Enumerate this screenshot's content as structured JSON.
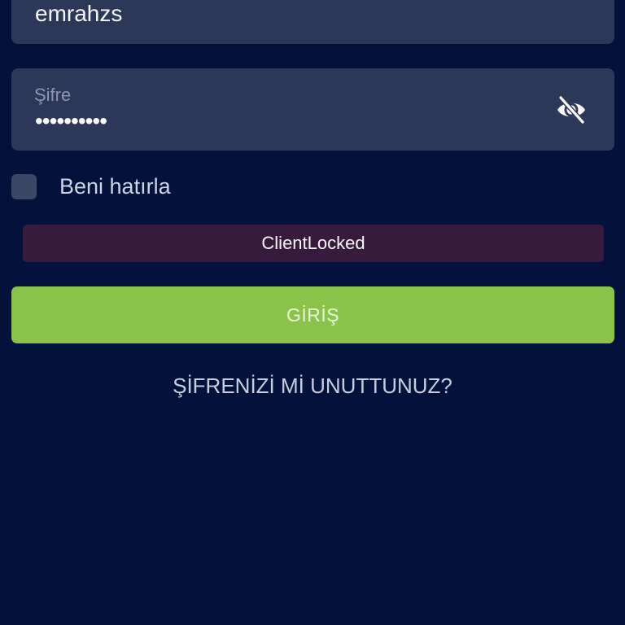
{
  "login_form": {
    "username": {
      "value": "emrahzs"
    },
    "password": {
      "label": "Şifre",
      "masked_value": "••••••••••",
      "visibility_icon": "eye-off-icon"
    },
    "remember_me": {
      "label": "Beni hatırla",
      "checked": false
    },
    "error_message": "ClientLocked",
    "submit_label": "GİRİŞ",
    "forgot_password_label": "ŞİFRENİZİ Mİ UNUTTUNUZ?"
  },
  "colors": {
    "background": "#03123a",
    "field_background": "#2b3858",
    "placeholder_text": "#8d97ae",
    "checkbox_background": "#3a4866",
    "error_background": "#381b3c",
    "accent_green": "#8bc34a",
    "secondary_text": "#c9cedd"
  }
}
